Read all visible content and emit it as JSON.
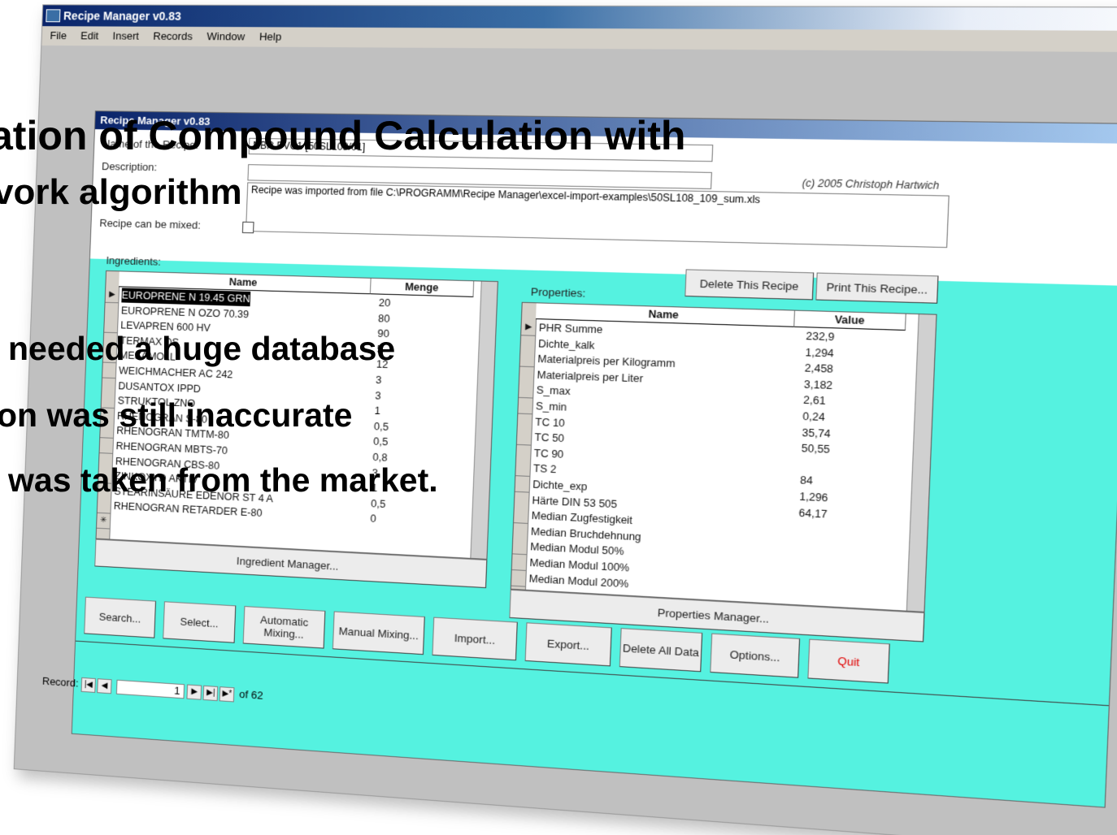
{
  "app": {
    "window_title": "Recipe Manager v0.83",
    "menu": [
      "File",
      "Edit",
      "Insert",
      "Records",
      "Window",
      "Help"
    ],
    "mdi_controls": [
      "_",
      "▫",
      "×"
    ],
    "form_title": "Recipe Manager v0.83"
  },
  "recipe": {
    "name_label": "Name of the Recipe:",
    "name_value": "NBR PVC1 [50SL108/01]",
    "description_label": "Description:",
    "description_value": "Recipe was imported from file C:\\PROGRAMM\\Recipe Manager\\excel-import-examples\\50SL108_109_sum.xls",
    "mixable_label": "Recipe can be mixed:",
    "copyright": "(c) 2005 Christoph Hartwich"
  },
  "ingredients": {
    "label": "Ingredients:",
    "columns": [
      "Name",
      "Menge"
    ],
    "rows": [
      {
        "name": "EUROPRENE N 19.45 GRN",
        "menge": "20"
      },
      {
        "name": "EUROPRENE N OZO 70.39",
        "menge": "80"
      },
      {
        "name": "LEVAPREN 600 HV",
        "menge": "90"
      },
      {
        "name": "TERMAX DS",
        "menge": "5"
      },
      {
        "name": "MESAMOLL",
        "menge": "12"
      },
      {
        "name": "WEICHMACHER AC 242",
        "menge": "3"
      },
      {
        "name": "DUSANTOX IPPD",
        "menge": "3"
      },
      {
        "name": "STRUKTOL ZNO",
        "menge": "1"
      },
      {
        "name": "RHENOGRAN S-80",
        "menge": "0,5"
      },
      {
        "name": "RHENOGRAN TMTM-80",
        "menge": "0,5"
      },
      {
        "name": "RHENOGRAN MBTS-70",
        "menge": "0,8"
      },
      {
        "name": "RHENOGRAN CBS-80",
        "menge": "3"
      },
      {
        "name": "ZINKOXYD AKTIV",
        "menge": "1"
      },
      {
        "name": "STEARINSÄURE EDENOR ST 4 A",
        "menge": "0,5"
      },
      {
        "name": "RHENOGRAN RETARDER E-80",
        "menge": "0"
      }
    ],
    "manager_label": "Ingredient Manager..."
  },
  "properties": {
    "label": "Properties:",
    "columns": [
      "Name",
      "Value"
    ],
    "rows": [
      {
        "name": "PHR Summe",
        "value": "232,9"
      },
      {
        "name": "Dichte_kalk",
        "value": "1,294"
      },
      {
        "name": "Materialpreis per Kilogramm",
        "value": "2,458"
      },
      {
        "name": "Materialpreis per Liter",
        "value": "3,182"
      },
      {
        "name": "S_max",
        "value": "2,61"
      },
      {
        "name": "S_min",
        "value": "0,24"
      },
      {
        "name": "TC 10",
        "value": "35,74"
      },
      {
        "name": "TC 50",
        "value": "50,55"
      },
      {
        "name": "TC 90",
        "value": ""
      },
      {
        "name": "TS 2",
        "value": "84"
      },
      {
        "name": "Dichte_exp",
        "value": "1,296"
      },
      {
        "name": "Härte DIN 53 505",
        "value": "64,17"
      },
      {
        "name": "Median Zugfestigkeit",
        "value": ""
      },
      {
        "name": "Median Bruchdehnung",
        "value": ""
      },
      {
        "name": "Median Modul 50%",
        "value": ""
      },
      {
        "name": "Median Modul 100%",
        "value": ""
      },
      {
        "name": "Median Modul 200%",
        "value": ""
      }
    ],
    "manager_label": "Properties Manager..."
  },
  "buttons": {
    "delete_recipe": "Delete This Recipe",
    "print_recipe": "Print This Recipe...",
    "search": "Search...",
    "select": "Select...",
    "automatic_mixing": "Automatic Mixing...",
    "manual_mixing": "Manual Mixing...",
    "import": "Import...",
    "export": "Export...",
    "delete_all": "Delete All Data",
    "options": "Options...",
    "quit": "Quit"
  },
  "record_nav": {
    "label": "Record:",
    "current": "1",
    "of_label": "of",
    "total": "62"
  },
  "slide_text": {
    "title_line1": "ation of Compound Calculation with",
    "title_line2": "vork algorithm",
    "bullet1": "needed a huge database",
    "bullet2": "on was still inaccurate",
    "bullet3": "was taken from the market."
  }
}
